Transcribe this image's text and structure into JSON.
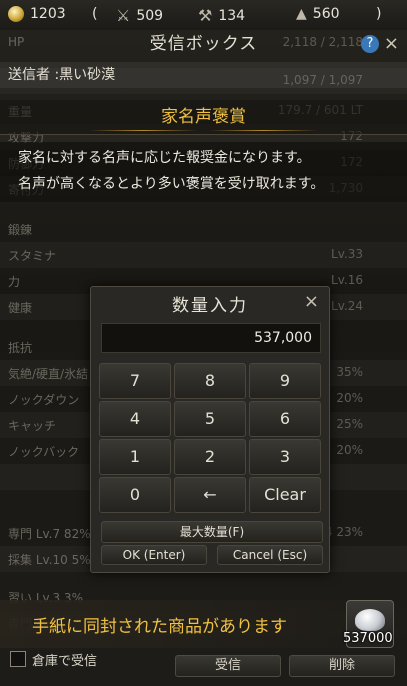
{
  "currency_bar": {
    "silver": "1203",
    "open_paren": "(",
    "combat": "509",
    "life": "134",
    "weight": "560",
    "close_paren": ")"
  },
  "background_stats": {
    "rows": [
      {
        "label": "HP",
        "value": "2,118 / 2,118"
      },
      {
        "label": "",
        "value": "1,097 / 1,097"
      },
      {
        "label": "重量",
        "value": "179.7 / 601 LT"
      },
      {
        "label": "攻撃力",
        "value": "172"
      },
      {
        "label": "防御力",
        "value": "172"
      },
      {
        "label": "寄付力",
        "value": "1,730"
      },
      {
        "label": "鍛錬",
        "value": ""
      },
      {
        "label": "スタミナ",
        "value": "Lv.33"
      },
      {
        "label": "力",
        "value": "Lv.16"
      },
      {
        "label": "健康",
        "value": "Lv.24"
      },
      {
        "label": "抵抗",
        "value": ""
      },
      {
        "label": "気絶/硬直/氷結",
        "value": "35%"
      },
      {
        "label": "ノックダウン",
        "value": "20%"
      },
      {
        "label": "キャッチ",
        "value": "25%"
      },
      {
        "label": "ノックバック",
        "value": "20%"
      },
      {
        "label": "",
        "value": ""
      },
      {
        "label": "専門 Lv.7 82%",
        "value": "Lv.4 23%"
      },
      {
        "label": "採集 Lv.10 5%",
        "value": ""
      },
      {
        "label": "習い Lv.3  3%",
        "value": ""
      },
      {
        "label": "専門 Lv.1",
        "value": ""
      }
    ]
  },
  "mailbox": {
    "title": "受信ボックス",
    "help_icon": "?",
    "close_icon": "×",
    "sender": "送信者 :黒い砂漠",
    "subject": "家名声褒賞",
    "body_line1": "家名に対する名声に応じた報奨金になります。",
    "body_line2": "名声が高くなるとより多い褒賞を受け取れます。",
    "attachment_notice": "手紙に同封された商品があります",
    "attachment_count": "537000",
    "warehouse_checkbox_label": "倉庫で受信",
    "receive_label": "受信",
    "delete_label": "削除"
  },
  "quantity_dialog": {
    "title": "数量入力",
    "close_icon": "×",
    "value": "537,000",
    "keys": [
      "7",
      "8",
      "9",
      "4",
      "5",
      "6",
      "1",
      "2",
      "3",
      "0",
      "←",
      "Clear"
    ],
    "max_label": "最大数量(F)",
    "ok_label": "OK (Enter)",
    "cancel_label": "Cancel (Esc)"
  },
  "colors": {
    "accent_gold": "#f0c040",
    "help_blue": "#3a78b8",
    "panel_bg": "#2a2824"
  }
}
